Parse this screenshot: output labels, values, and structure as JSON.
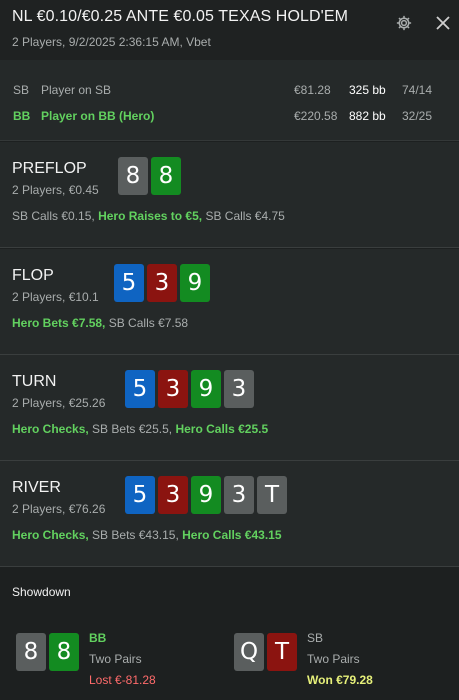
{
  "header": {
    "title": "NL €0.10/€0.25 ANTE €0.05 TEXAS HOLD'EM",
    "subtitle": "2 Players, 9/2/2025 2:36:15 AM, Vbet",
    "icons": {
      "settings": "gear-icon",
      "close": "close-icon"
    }
  },
  "players": [
    {
      "position": "SB",
      "name": "Player on SB",
      "stack": "€81.28",
      "bb": "325 bb",
      "stat": "74/14"
    },
    {
      "position": "BB",
      "name": "Player on BB (Hero)",
      "stack": "€220.58",
      "bb": "882 bb",
      "stat": "32/25"
    }
  ],
  "streets": [
    {
      "name": "PREFLOP",
      "info": "2 Players, €0.45",
      "cards": [
        {
          "rank": "8",
          "suit": "grey"
        },
        {
          "rank": "8",
          "suit": "green"
        }
      ],
      "actions": [
        {
          "text": "SB Calls €0.15",
          "hero": false
        },
        {
          "text": "Hero Raises to €5",
          "hero": true
        },
        {
          "text": "SB Calls €4.75",
          "hero": false
        }
      ]
    },
    {
      "name": "FLOP",
      "info": "2 Players, €10.1",
      "cards": [
        {
          "rank": "5",
          "suit": "blue"
        },
        {
          "rank": "3",
          "suit": "red"
        },
        {
          "rank": "9",
          "suit": "green"
        }
      ],
      "actions": [
        {
          "text": "Hero Bets €7.58",
          "hero": true
        },
        {
          "text": "SB Calls €7.58",
          "hero": false
        }
      ]
    },
    {
      "name": "TURN",
      "info": "2 Players, €25.26",
      "cards": [
        {
          "rank": "5",
          "suit": "blue"
        },
        {
          "rank": "3",
          "suit": "red"
        },
        {
          "rank": "9",
          "suit": "green"
        },
        {
          "rank": "3",
          "suit": "grey"
        }
      ],
      "actions": [
        {
          "text": "Hero Checks",
          "hero": true
        },
        {
          "text": "SB Bets €25.5",
          "hero": false
        },
        {
          "text": "Hero Calls €25.5",
          "hero": true
        }
      ]
    },
    {
      "name": "RIVER",
      "info": "2 Players, €76.26",
      "cards": [
        {
          "rank": "5",
          "suit": "blue"
        },
        {
          "rank": "3",
          "suit": "red"
        },
        {
          "rank": "9",
          "suit": "green"
        },
        {
          "rank": "3",
          "suit": "grey"
        },
        {
          "rank": "T",
          "suit": "grey"
        }
      ],
      "actions": [
        {
          "text": "Hero Checks",
          "hero": true
        },
        {
          "text": "SB Bets €43.15",
          "hero": false
        },
        {
          "text": "Hero Calls €43.15",
          "hero": true
        }
      ]
    }
  ],
  "showdown": {
    "title": "Showdown",
    "players": [
      {
        "position": "BB",
        "hand": "Two Pairs",
        "result": "Lost €-81.28",
        "outcome": "lost",
        "cards": [
          {
            "rank": "8",
            "suit": "grey"
          },
          {
            "rank": "8",
            "suit": "green"
          }
        ]
      },
      {
        "position": "SB",
        "hand": "Two Pairs",
        "result": "Won €79.28",
        "outcome": "won",
        "cards": [
          {
            "rank": "Q",
            "suit": "grey"
          },
          {
            "rank": "T",
            "suit": "red"
          }
        ]
      }
    ]
  },
  "colors": {
    "background": "#1d2020",
    "section": "#252929",
    "hero_green": "#62d15f",
    "card_grey": "#5a5e5e",
    "card_green": "#138b21",
    "card_blue": "#0f64c2",
    "card_red": "#8b1410",
    "lost": "#ff6b6b",
    "won": "#e6f07a"
  }
}
